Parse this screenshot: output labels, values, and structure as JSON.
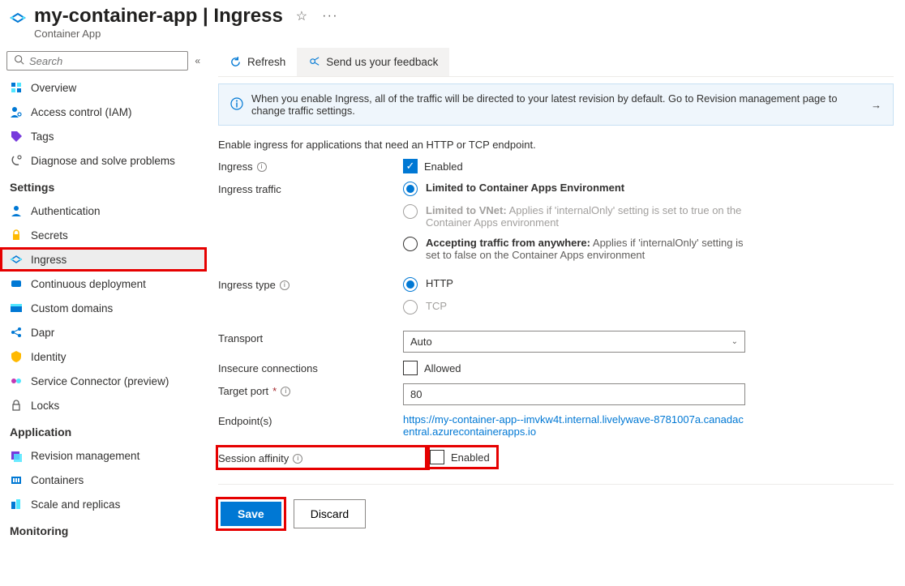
{
  "header": {
    "title": "my-container-app | Ingress",
    "subtitle": "Container App"
  },
  "sidebar": {
    "search_placeholder": "Search",
    "items": {
      "overview": "Overview",
      "iam": "Access control (IAM)",
      "tags": "Tags",
      "diagnose": "Diagnose and solve problems"
    },
    "settings_label": "Settings",
    "settings": {
      "auth": "Authentication",
      "secrets": "Secrets",
      "ingress": "Ingress",
      "cd": "Continuous deployment",
      "domains": "Custom domains",
      "dapr": "Dapr",
      "identity": "Identity",
      "serviceconnector": "Service Connector (preview)",
      "locks": "Locks"
    },
    "application_label": "Application",
    "application": {
      "revisions": "Revision management",
      "containers": "Containers",
      "scale": "Scale and replicas"
    },
    "monitoring_label": "Monitoring"
  },
  "toolbar": {
    "refresh": "Refresh",
    "feedback": "Send us your feedback"
  },
  "info": {
    "text": "When you enable Ingress, all of the traffic will be directed to your latest revision by default. Go to Revision management page to change traffic settings."
  },
  "description": "Enable ingress for applications that need an HTTP or TCP endpoint.",
  "form": {
    "ingress_label": "Ingress",
    "ingress_enabled_label": "Enabled",
    "traffic_label": "Ingress traffic",
    "traffic_opts": {
      "env_bold": "Limited to Container Apps Environment",
      "vnet_bold": "Limited to VNet:",
      "vnet_desc": " Applies if 'internalOnly' setting is set to true on the Container Apps environment",
      "anywhere_bold": "Accepting traffic from anywhere:",
      "anywhere_desc": " Applies if 'internalOnly' setting is set to false on the Container Apps environment"
    },
    "type_label": "Ingress type",
    "type_http": "HTTP",
    "type_tcp": "TCP",
    "transport_label": "Transport",
    "transport_value": "Auto",
    "insecure_label": "Insecure connections",
    "insecure_allowed": "Allowed",
    "port_label": "Target port",
    "port_value": "80",
    "endpoints_label": "Endpoint(s)",
    "endpoints_url": "https://my-container-app--imvkw4t.internal.livelywave-8781007a.canadacentral.azurecontainerapps.io",
    "affinity_label": "Session affinity",
    "affinity_enabled": "Enabled"
  },
  "actions": {
    "save": "Save",
    "discard": "Discard"
  }
}
